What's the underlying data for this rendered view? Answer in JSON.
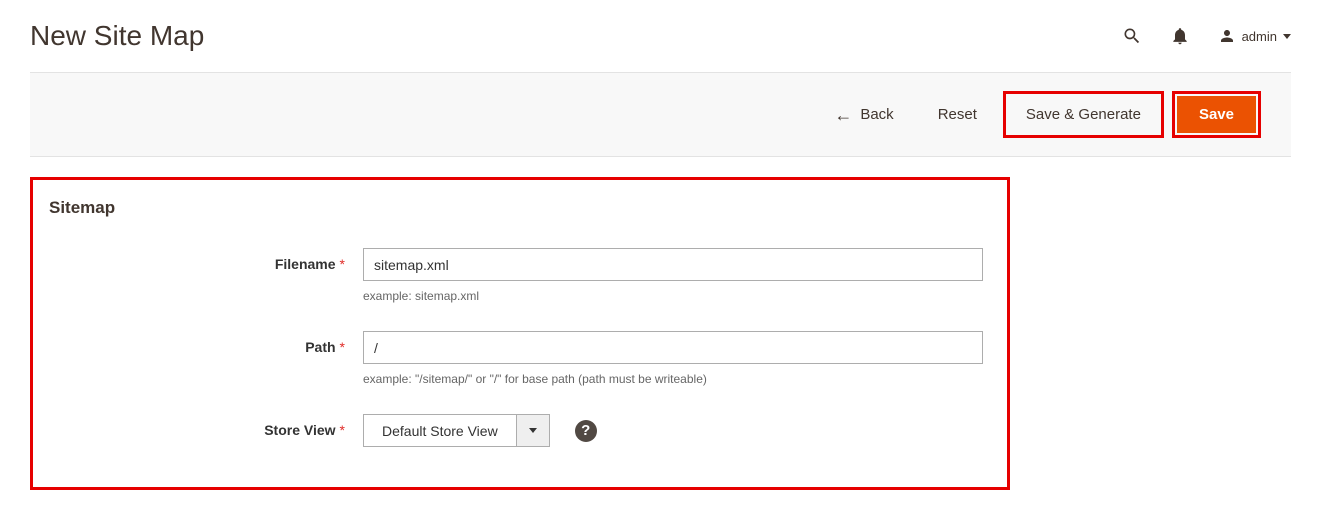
{
  "header": {
    "title": "New Site Map",
    "user_label": "admin"
  },
  "actions": {
    "back": "Back",
    "reset": "Reset",
    "save_generate": "Save & Generate",
    "save": "Save"
  },
  "form": {
    "section_title": "Sitemap",
    "filename": {
      "label": "Filename",
      "value": "sitemap.xml",
      "hint": "example: sitemap.xml"
    },
    "path": {
      "label": "Path",
      "value": "/",
      "hint": "example: \"/sitemap/\" or \"/\" for base path (path must be writeable)"
    },
    "store_view": {
      "label": "Store View",
      "selected": "Default Store View"
    }
  }
}
